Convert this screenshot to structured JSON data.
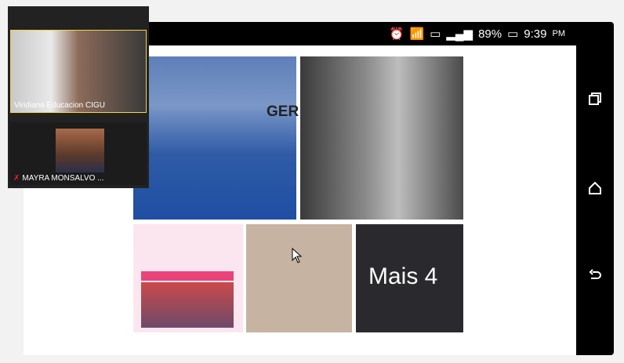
{
  "status_bar": {
    "battery_percent": "89%",
    "time": "9:39",
    "meridiem": "PM",
    "icons": [
      "alarm-icon",
      "wifi-icon",
      "sim-icon",
      "signal-icon",
      "battery-icon"
    ]
  },
  "gallery": {
    "jersey_text": "GER",
    "more_label": "Mais 4"
  },
  "participants": [
    {
      "name": "Viridiana Educacion CIGU"
    },
    {
      "name": "MAYRA MONSALVO ..."
    }
  ],
  "nav_icons": [
    "recent-apps-icon",
    "home-icon",
    "back-icon"
  ],
  "colors": {
    "status_bar": "#000000",
    "nav_bar": "#000000",
    "active_speaker_border": "#f7d24a",
    "mic_muted": "#ee2222"
  }
}
